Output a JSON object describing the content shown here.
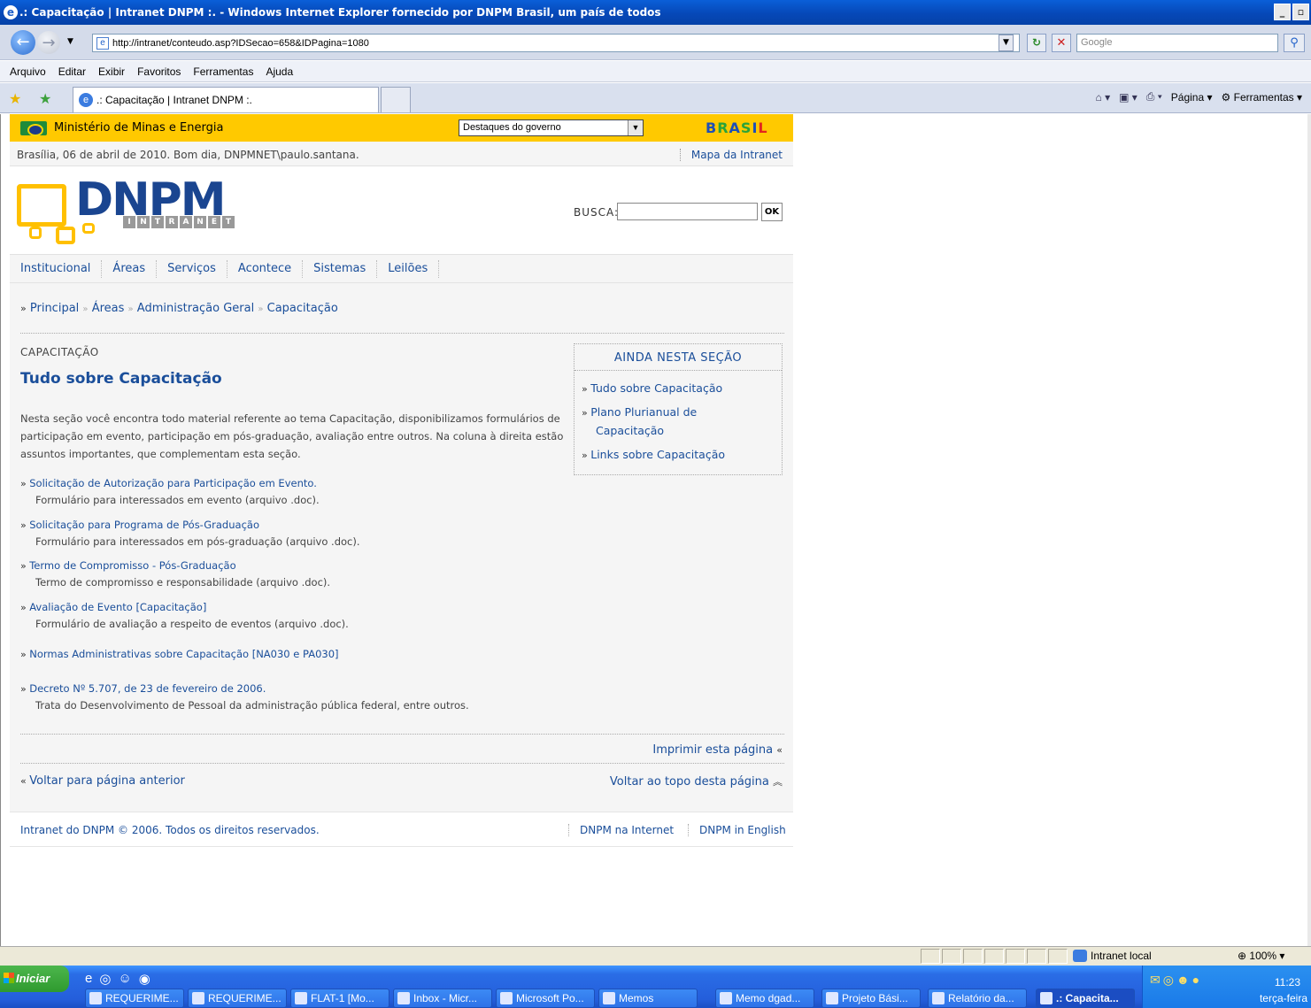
{
  "browser": {
    "window_title": ".: Capacitação | Intranet DNPM :. - Windows Internet Explorer fornecido por DNPM Brasil, um país de todos",
    "url": "http://intranet/conteudo.asp?IDSecao=658&IDPagina=1080",
    "search_placeholder": "Google",
    "menu": [
      "Arquivo",
      "Editar",
      "Exibir",
      "Favoritos",
      "Ferramentas",
      "Ajuda"
    ],
    "tab_title": ".: Capacitação | Intranet DNPM :.",
    "command_bar": {
      "pagina": "Página",
      "ferramentas": "Ferramentas"
    },
    "status_zone": "Intranet local",
    "zoom": "100%"
  },
  "site": {
    "gov_bar": {
      "ministry": "Ministério de Minas e Energia",
      "select_value": "Destaques do governo",
      "brasil": "BRASIL"
    },
    "date_greeting": "Brasília, 06 de abril de 2010.  Bom dia, DNPMNET\\paulo.santana.",
    "map_link": "Mapa da Intranet",
    "logo_text": "DNPM",
    "logo_sub": [
      "I",
      "N",
      "T",
      "R",
      "A",
      "N",
      "E",
      "T"
    ],
    "search_label": "BUSCA:",
    "search_button": "OK",
    "nav": [
      "Institucional",
      "Áreas",
      "Serviços",
      "Acontece",
      "Sistemas",
      "Leilões"
    ],
    "breadcrumb": {
      "prefix": "»",
      "principal": "Principal",
      "sep": "»",
      "areas": "Áreas",
      "admin": "Administração Geral",
      "current": "Capacitação"
    },
    "section_label": "CAPACITAÇÃO",
    "page_title": "Tudo sobre Capacitação",
    "intro": "Nesta seção você encontra todo material referente ao tema Capacitação, disponibilizamos formulários de participação em evento, participação em pós-graduação, avaliação entre outros. Na coluna à direita estão assuntos importantes, que complementam esta seção.",
    "items": [
      {
        "link": "Solicitação de Autorização para Participação em Evento.",
        "desc": "Formulário para interessados em evento (arquivo .doc)."
      },
      {
        "link": "Solicitação para Programa de Pós-Graduação",
        "desc": "Formulário para interessados em pós-graduação (arquivo .doc)."
      },
      {
        "link": "Termo de Compromisso - Pós-Graduação",
        "desc": "Termo de compromisso e responsabilidade (arquivo .doc)."
      },
      {
        "link": "Avaliação de Evento [Capacitação]",
        "desc": "Formulário de avaliação a respeito de eventos (arquivo .doc)."
      },
      {
        "link": "Normas Administrativas sobre Capacitação [NA030 e PA030]",
        "desc": ""
      },
      {
        "link": "Decreto Nº 5.707, de 23 de fevereiro de 2006.",
        "desc": "Trata do Desenvolvimento de Pessoal da administração pública federal, entre outros."
      }
    ],
    "aside": {
      "title": "AINDA NESTA SEÇÃO",
      "items": [
        "Tudo sobre Capacitação",
        "Plano Plurianual de Capacitação",
        "Links sobre Capacitação"
      ]
    },
    "print_link": "Imprimir esta página",
    "back_link": "Voltar para página anterior",
    "top_link": "Voltar ao topo desta página",
    "footer": {
      "copyright": "Intranet do DNPM © 2006. Todos os direitos reservados.",
      "link1": "DNPM na Internet",
      "link2": "DNPM in English"
    }
  },
  "taskbar": {
    "start": "Iniciar",
    "tasks": [
      "REQUERIME...",
      "REQUERIME...",
      "FLAT-1  [Mo...",
      "Inbox - Micr...",
      "Microsoft Po...",
      "Memos",
      "Memo dgad...",
      "Projeto Bási...",
      "Relatório da...",
      ".: Capacita..."
    ],
    "clock": "11:23",
    "day": "terça-feira"
  }
}
